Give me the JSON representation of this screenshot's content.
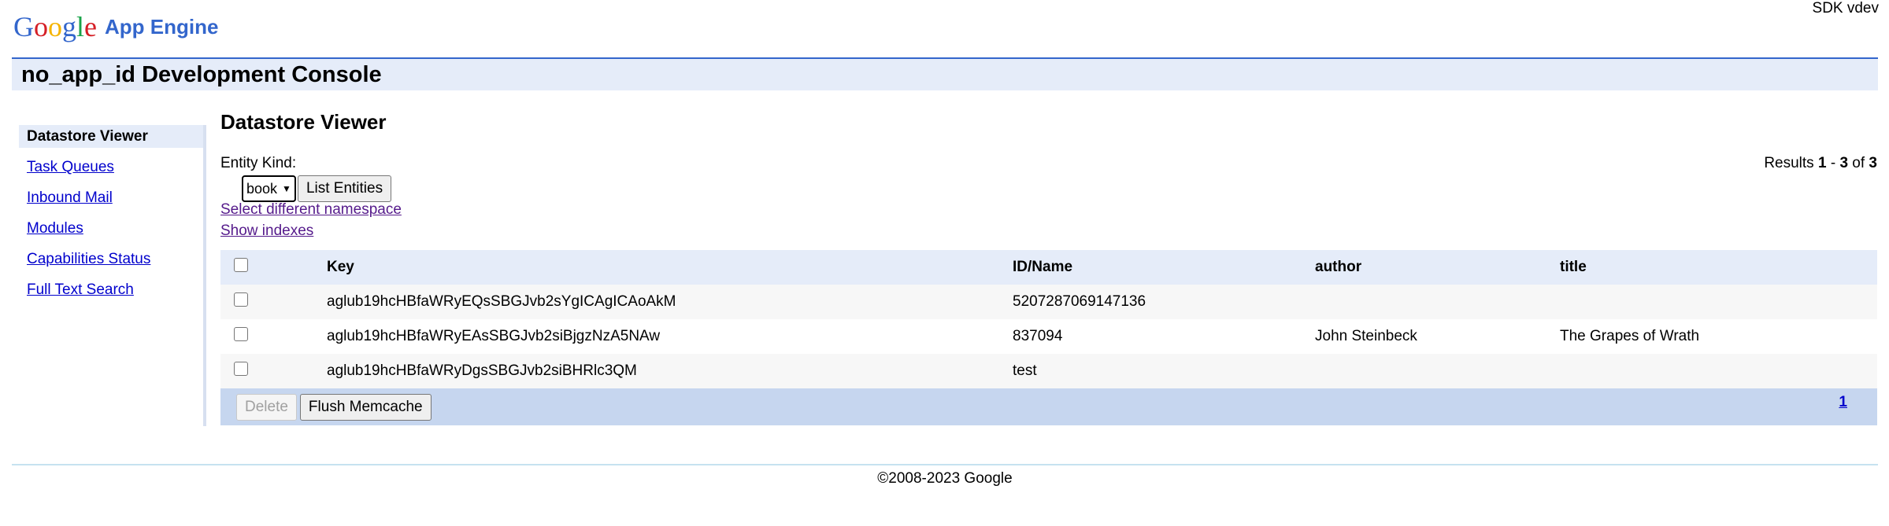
{
  "header": {
    "logo_google": "Google",
    "logo_product": "App Engine",
    "sdk_version": "SDK vdev",
    "console_title": "no_app_id Development Console"
  },
  "sidebar": {
    "items": [
      {
        "label": "Datastore Viewer",
        "active": true
      },
      {
        "label": "Task Queues",
        "active": false
      },
      {
        "label": "Inbound Mail",
        "active": false
      },
      {
        "label": "Modules",
        "active": false
      },
      {
        "label": "Capabilities Status",
        "active": false
      },
      {
        "label": "Full Text Search",
        "active": false
      }
    ]
  },
  "main": {
    "heading": "Datastore Viewer",
    "entity_kind_label": "Entity Kind:",
    "selected_kind": "book",
    "list_button": "List Entities",
    "results": {
      "prefix": "Results ",
      "start": "1",
      "sep": " - ",
      "end": "3",
      "of": " of ",
      "total": "3"
    },
    "links": {
      "namespace": "Select different namespace",
      "indexes": "Show indexes"
    },
    "table": {
      "columns": [
        "Key",
        "ID/Name",
        "author",
        "title"
      ],
      "rows": [
        {
          "key": "aglub19hcHBfaWRyEQsSBGJvb2sYgICAgICAoAkM",
          "id": "5207287069147136",
          "author": "",
          "title": ""
        },
        {
          "key": "aglub19hcHBfaWRyEAsSBGJvb2siBjgzNzA5NAw",
          "id": "837094",
          "author": "John Steinbeck",
          "title": "The Grapes of Wrath"
        },
        {
          "key": "aglub19hcHBfaWRyDgsSBGJvb2siBHRlc3QM",
          "id": "test",
          "author": "",
          "title": ""
        }
      ]
    },
    "delete_button": "Delete",
    "flush_button": "Flush Memcache",
    "page_number": "1"
  },
  "footer": {
    "copyright": "©2008-2023 Google"
  },
  "colors": {
    "brand_blue": "#3366cc",
    "title_bg": "#e5ecf9",
    "footer_bar_bg": "#c6d6ef",
    "link": "#0000cc"
  }
}
